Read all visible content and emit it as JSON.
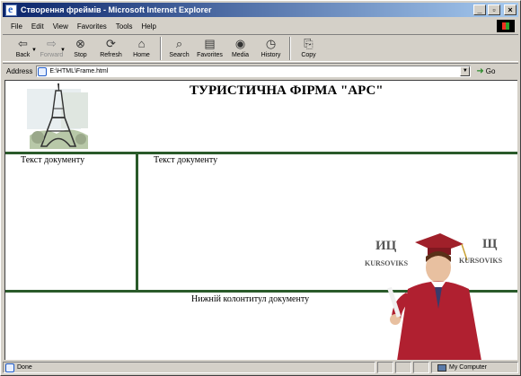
{
  "window": {
    "title": "Створення фреймів - Microsoft Internet Explorer",
    "controls": [
      "_",
      "▫",
      "×"
    ]
  },
  "menu": {
    "items": [
      "File",
      "Edit",
      "View",
      "Favorites",
      "Tools",
      "Help"
    ]
  },
  "toolbar": {
    "back": "Back",
    "forward": "Forward",
    "stop": "Stop",
    "refresh": "Refresh",
    "home": "Home",
    "search": "Search",
    "favorites": "Favorites",
    "media": "Media",
    "history": "History",
    "copy": "Copy"
  },
  "address": {
    "label": "Address",
    "value": "E:\\HTML\\Frame.html",
    "go": "Go"
  },
  "page": {
    "heading": "ТУРИСТИЧНА ФІРМА \"АРС\"",
    "left_text": "Текст документу",
    "right_text": "Текст документу",
    "footer_text": "Нижній колонтитул документу"
  },
  "watermark": {
    "left_title": "ИЦ",
    "left_sub": "KURSOVIKS",
    "right_title": "Щ",
    "right_sub": "KURSOVIKS"
  },
  "status": {
    "text": "Done",
    "zone": "My Computer"
  },
  "colors": {
    "titlebar_start": "#0a246a",
    "titlebar_end": "#a6caf0",
    "frame_border": "#2a5a2a",
    "chrome": "#d4d0c8"
  }
}
